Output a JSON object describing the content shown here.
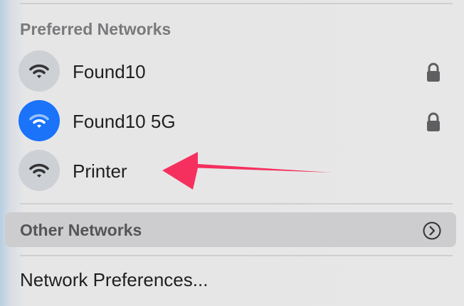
{
  "section_title": "Preferred Networks",
  "networks": [
    {
      "name": "Found10",
      "icon": "wifi-icon",
      "active": false,
      "locked": true
    },
    {
      "name": "Found10 5G",
      "icon": "wifi-icon",
      "active": true,
      "locked": true
    },
    {
      "name": "Printer",
      "icon": "wifi-icon",
      "active": false,
      "locked": false
    }
  ],
  "other_networks": {
    "label": "Other Networks",
    "icon": "chevron-right-circle-icon"
  },
  "preferences_label": "Network Preferences...",
  "annotation": {
    "icon": "arrow-icon",
    "color": "#f5305f"
  },
  "colors": {
    "active": "#1a73f8",
    "inactive": "#cdd0d4",
    "highlight": "#cdcdcf"
  }
}
